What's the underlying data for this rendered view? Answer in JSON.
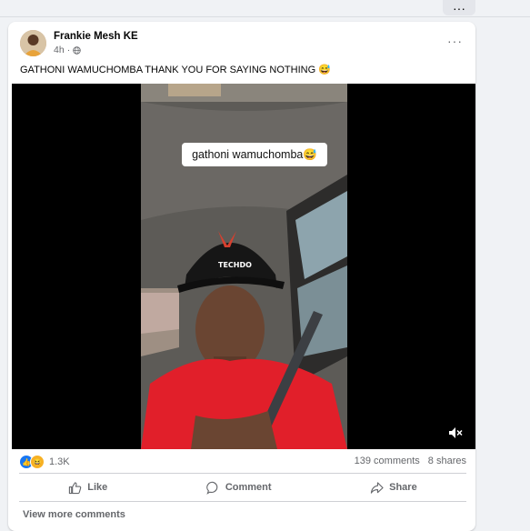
{
  "top_bar": {
    "more_label": "···"
  },
  "post": {
    "author": "Frankie Mesh KE",
    "time": "4h",
    "more_label": "···",
    "caption": "GATHONI WAMUCHOMBA THANK YOU FOR SAYING NOTHING 😅",
    "video": {
      "overlay_text": "gathoni wamuchomba😅",
      "cap_text": "TECHDO"
    },
    "reactions": {
      "count": "1.3K",
      "types": [
        "like-icon",
        "haha-icon"
      ]
    },
    "comments": "139 comments",
    "shares": "8 shares",
    "actions": {
      "like": "Like",
      "comment": "Comment",
      "share": "Share"
    },
    "view_more": "View more comments"
  },
  "colors": {
    "background": "#f0f2f5",
    "card": "#ffffff",
    "secondary_text": "#65676b",
    "like_blue": "#1877f2",
    "shirt_red": "#e11f2a"
  }
}
